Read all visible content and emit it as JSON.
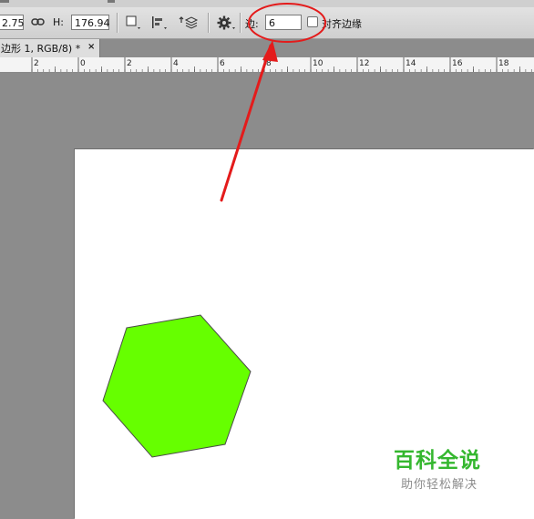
{
  "options_bar": {
    "width_value": "2.75",
    "height_label": "H:",
    "height_value": "176.94",
    "sides_label": "边:",
    "sides_value": "6",
    "align_edges_label": "对齐边缘",
    "align_edges_checked": false
  },
  "document_tab": {
    "title": "边形 1, RGB/8) *",
    "close_glyph": "×"
  },
  "ruler": {
    "labels": [
      "2",
      "0",
      "2",
      "4",
      "6",
      "8",
      "10",
      "12",
      "14",
      "16",
      "18"
    ]
  },
  "shape": {
    "type": "hexagon",
    "fill": "#66ff00"
  },
  "annotation": {
    "color": "#e41b1b",
    "highlights": "sides-input"
  },
  "watermark": {
    "title": "百科全说",
    "subtitle": "助你轻松解决",
    "title_color": "#35b72f"
  }
}
